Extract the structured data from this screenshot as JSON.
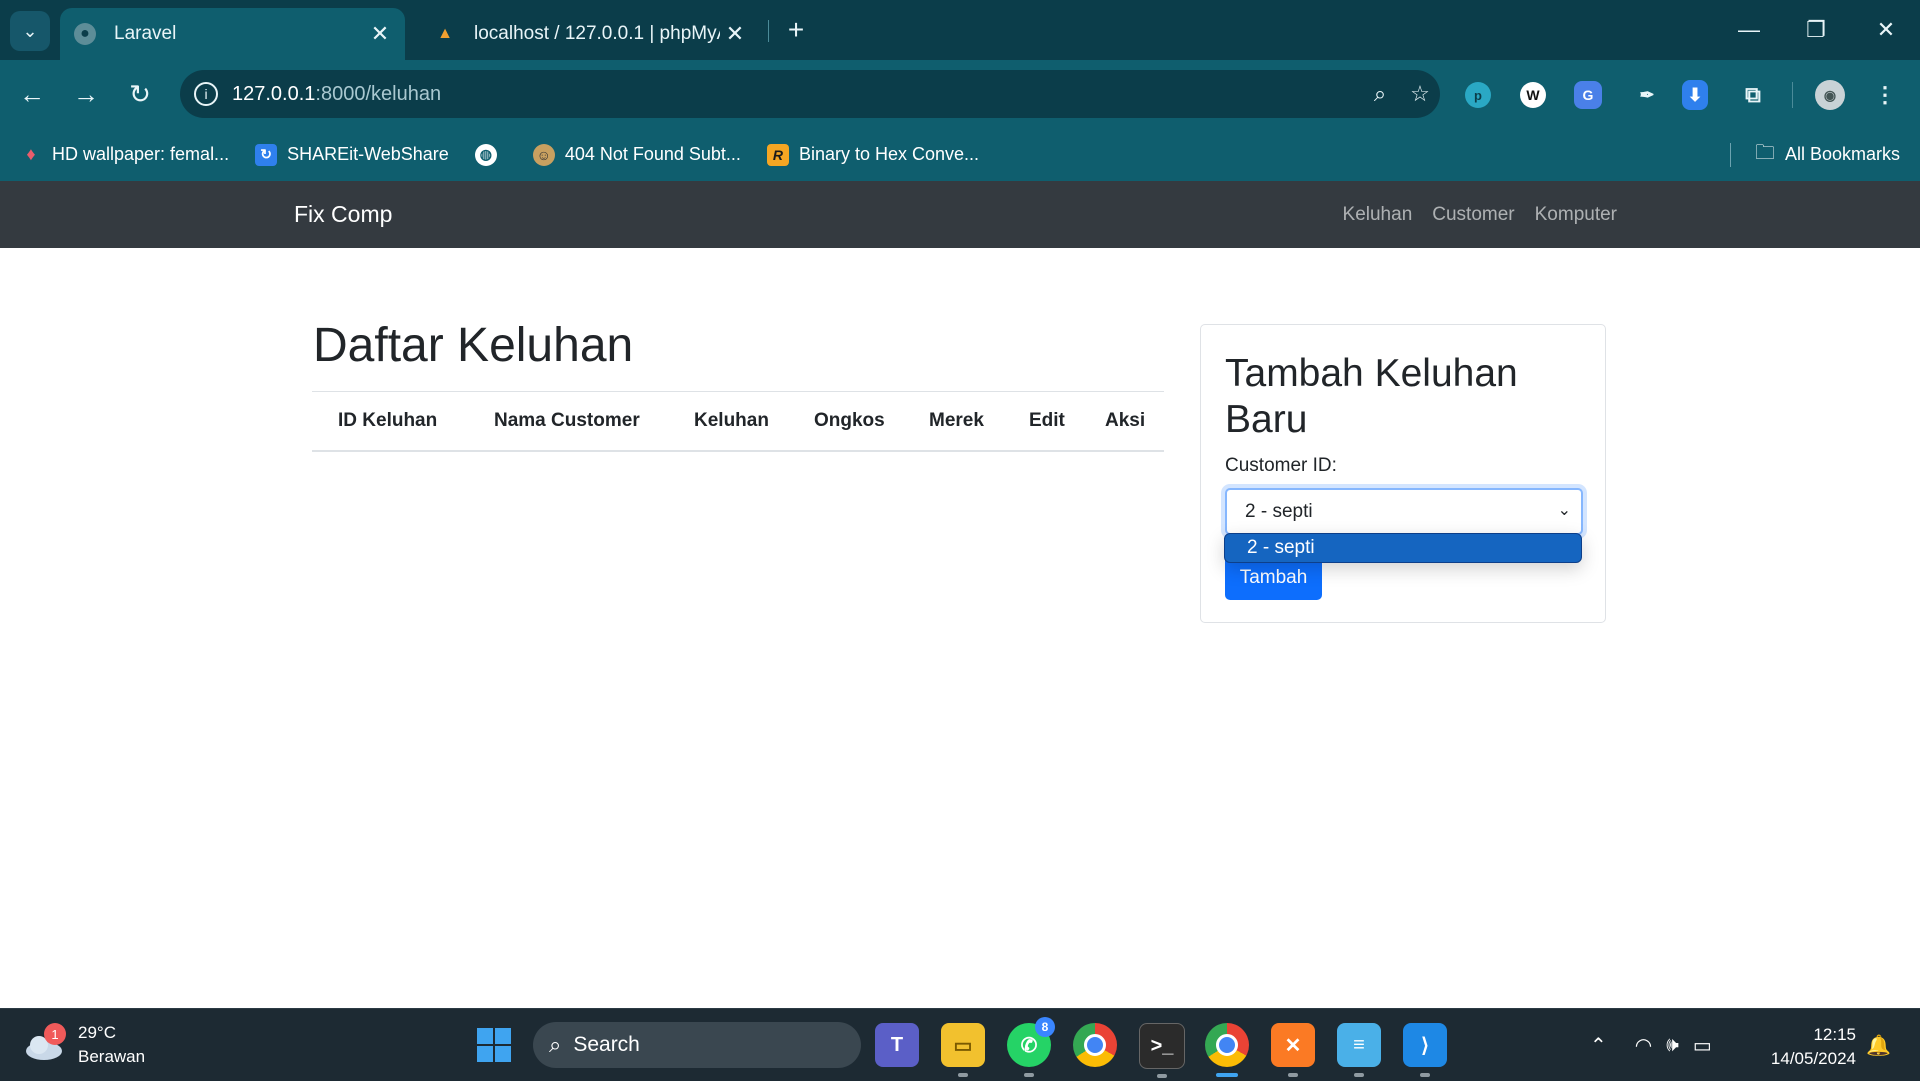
{
  "browser": {
    "tabs": [
      {
        "title": "Laravel",
        "active": true
      },
      {
        "title": "localhost / 127.0.0.1 | phpMyAd",
        "active": false
      }
    ],
    "url_host": "127.0.0.1",
    "url_path": ":8000/keluhan",
    "bookmarks": [
      {
        "label": "HD wallpaper: femal...",
        "icon": "flame-icon"
      },
      {
        "label": "SHAREit-WebShare",
        "icon": "shareit-icon"
      },
      {
        "label": "",
        "icon": "globe-icon"
      },
      {
        "label": "404 Not Found Subt...",
        "icon": "avatar-icon"
      },
      {
        "label": "Binary to Hex Conve...",
        "icon": "r-icon"
      }
    ],
    "all_bookmarks": "All Bookmarks"
  },
  "navbar": {
    "brand": "Fix Comp",
    "links": [
      "Keluhan",
      "Customer",
      "Komputer"
    ]
  },
  "main": {
    "title": "Daftar Keluhan",
    "table_headers": [
      "ID Keluhan",
      "Nama Customer",
      "Keluhan",
      "Ongkos",
      "Merek",
      "Edit",
      "Aksi"
    ],
    "rows": []
  },
  "form": {
    "title": "Tambah Keluhan Baru",
    "customer_label": "Customer ID:",
    "customer_selected": "2 - septi",
    "customer_options": [
      "2 - septi"
    ],
    "submit_label": "Tambah"
  },
  "taskbar": {
    "weather_temp": "29°C",
    "weather_desc": "Berawan",
    "weather_badge": "1",
    "search_placeholder": "Search",
    "whatsapp_badge": "8",
    "time": "12:15",
    "date": "14/05/2024"
  },
  "colors": {
    "navbar_bg": "#343a40",
    "primary": "#0d6efd",
    "browser_frame": "#0f5e6e"
  }
}
